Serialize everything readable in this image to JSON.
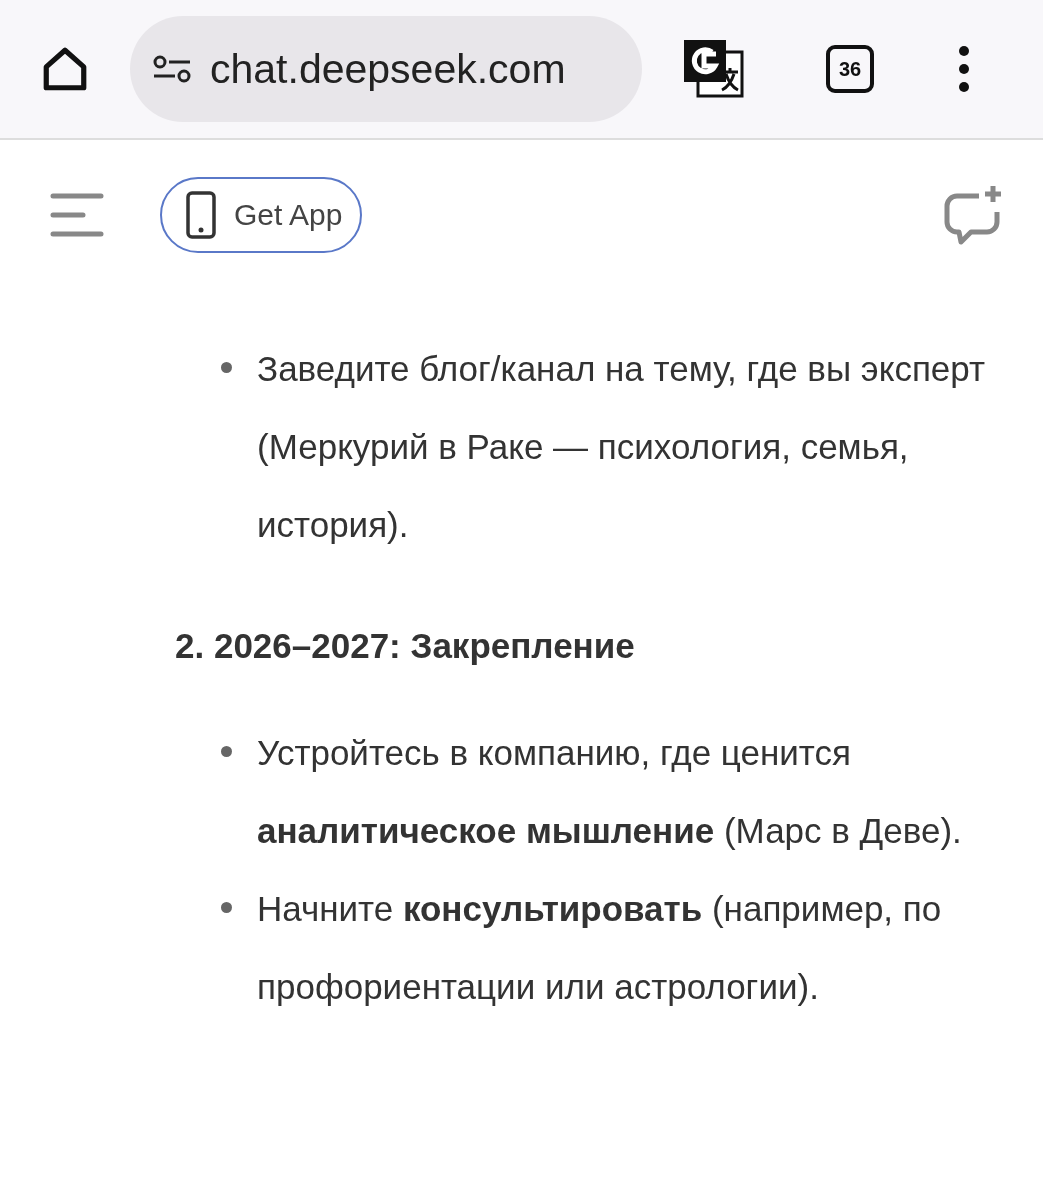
{
  "browser": {
    "url": "chat.deepseek.com",
    "tab_count": "36"
  },
  "header": {
    "get_app": "Get App"
  },
  "content": [
    {
      "kind": "bullets",
      "items": [
        "Заведите блог/канал на тему, где вы эксперт (Меркурий в Раке — психология, семья, история)."
      ]
    },
    {
      "kind": "heading",
      "text": "2. 2026–2027: Закрепление"
    },
    {
      "kind": "bullets",
      "items": [
        "Устройтесь в компанию, где ценится **аналитическое мышление** (Марс в Деве).",
        "Начните **консультировать** (например, по профориентации или астрологии)."
      ]
    }
  ]
}
